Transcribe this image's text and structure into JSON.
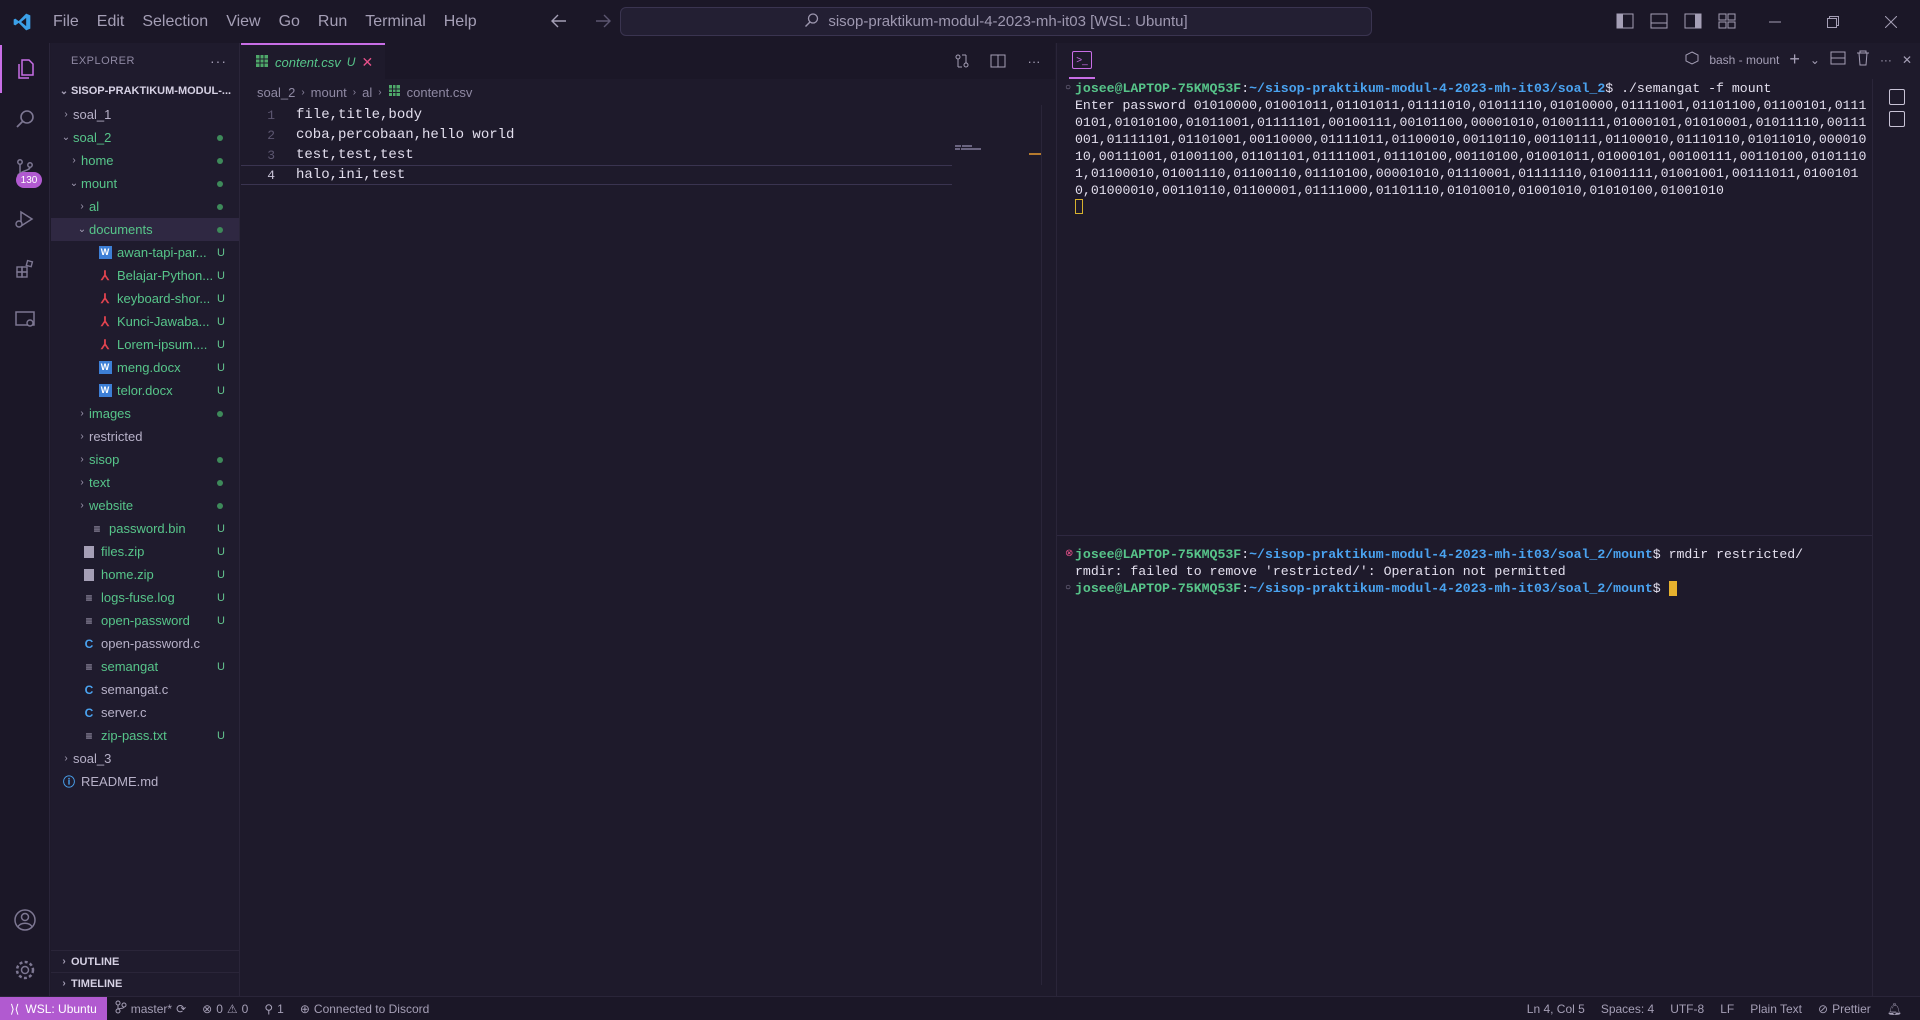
{
  "menubar": [
    "File",
    "Edit",
    "Selection",
    "View",
    "Go",
    "Run",
    "Terminal",
    "Help"
  ],
  "command_center": "sisop-praktikum-modul-4-2023-mh-it03 [WSL: Ubuntu]",
  "activity": {
    "scm_badge": "130"
  },
  "explorer": {
    "title": "EXPLORER",
    "root": "SISOP-PRAKTIKUM-MODUL-...",
    "items": [
      {
        "name": "soal_1",
        "indent": 0,
        "type": "folder-closed",
        "status": "",
        "color": "dim"
      },
      {
        "name": "soal_2",
        "indent": 0,
        "type": "folder-open",
        "status": "dot",
        "color": "green"
      },
      {
        "name": "home",
        "indent": 1,
        "type": "folder-closed",
        "status": "dot",
        "color": "green"
      },
      {
        "name": "mount",
        "indent": 1,
        "type": "folder-open",
        "status": "dot",
        "color": "green"
      },
      {
        "name": "al",
        "indent": 2,
        "type": "folder-closed",
        "status": "dot",
        "color": "green"
      },
      {
        "name": "documents",
        "indent": 2,
        "type": "folder-open",
        "status": "dot",
        "color": "green",
        "selected": true
      },
      {
        "name": "awan-tapi-par...",
        "indent": 3,
        "type": "word",
        "status": "U",
        "color": "green"
      },
      {
        "name": "Belajar-Python...",
        "indent": 3,
        "type": "pdf",
        "status": "U",
        "color": "green"
      },
      {
        "name": "keyboard-shor...",
        "indent": 3,
        "type": "pdf",
        "status": "U",
        "color": "green"
      },
      {
        "name": "Kunci-Jawaba...",
        "indent": 3,
        "type": "pdf",
        "status": "U",
        "color": "green"
      },
      {
        "name": "Lorem-ipsum....",
        "indent": 3,
        "type": "pdf",
        "status": "U",
        "color": "green"
      },
      {
        "name": "meng.docx",
        "indent": 3,
        "type": "word",
        "status": "U",
        "color": "green"
      },
      {
        "name": "telor.docx",
        "indent": 3,
        "type": "word",
        "status": "U",
        "color": "green"
      },
      {
        "name": "images",
        "indent": 2,
        "type": "folder-closed",
        "status": "dot",
        "color": "green"
      },
      {
        "name": "restricted",
        "indent": 2,
        "type": "folder-closed",
        "status": "",
        "color": "dim"
      },
      {
        "name": "sisop",
        "indent": 2,
        "type": "folder-closed",
        "status": "dot",
        "color": "green"
      },
      {
        "name": "text",
        "indent": 2,
        "type": "folder-closed",
        "status": "dot",
        "color": "green"
      },
      {
        "name": "website",
        "indent": 2,
        "type": "folder-closed",
        "status": "dot",
        "color": "green"
      },
      {
        "name": "password.bin",
        "indent": 2,
        "type": "text",
        "status": "U",
        "color": "green"
      },
      {
        "name": "files.zip",
        "indent": 1,
        "type": "zip",
        "status": "U",
        "color": "green"
      },
      {
        "name": "home.zip",
        "indent": 1,
        "type": "zip",
        "status": "U",
        "color": "green"
      },
      {
        "name": "logs-fuse.log",
        "indent": 1,
        "type": "text",
        "status": "U",
        "color": "green"
      },
      {
        "name": "open-password",
        "indent": 1,
        "type": "text",
        "status": "U",
        "color": "green"
      },
      {
        "name": "open-password.c",
        "indent": 1,
        "type": "c",
        "status": "",
        "color": "dim"
      },
      {
        "name": "semangat",
        "indent": 1,
        "type": "text",
        "status": "U",
        "color": "green"
      },
      {
        "name": "semangat.c",
        "indent": 1,
        "type": "c",
        "status": "",
        "color": "dim"
      },
      {
        "name": "server.c",
        "indent": 1,
        "type": "c",
        "status": "",
        "color": "dim"
      },
      {
        "name": "zip-pass.txt",
        "indent": 1,
        "type": "text",
        "status": "U",
        "color": "green"
      },
      {
        "name": "soal_3",
        "indent": 0,
        "type": "folder-closed",
        "status": "",
        "color": "dim"
      },
      {
        "name": "README.md",
        "indent": -1,
        "type": "info",
        "status": "",
        "color": "dim"
      }
    ],
    "outline": "OUTLINE",
    "timeline": "TIMELINE"
  },
  "editor": {
    "tab": {
      "name": "content.csv",
      "modified": "U"
    },
    "breadcrumb": [
      "soal_2",
      "mount",
      "al",
      "content.csv"
    ],
    "lines": [
      {
        "n": "1",
        "text": "file,title,body"
      },
      {
        "n": "2",
        "text": "coba,percobaan,hello world"
      },
      {
        "n": "3",
        "text": "test,test,test"
      },
      {
        "n": "4",
        "text": "halo,ini,test"
      }
    ]
  },
  "terminal": {
    "tab_label": "bash - mount",
    "pane1": {
      "user": "josee@LAPTOP-75KMQ53F",
      "path": "~/sisop-praktikum-modul-4-2023-mh-it03/soal_2",
      "command": "./semangat -f mount",
      "output": "Enter password 01010000,01001011,01101011,01111010,01011110,01010000,01111001,01101100,01100101,01110101,01010100,01011001,01111101,00100111,00101100,00001010,01001111,01000101,01010001,01011110,00111001,01111101,01101001,00110000,01111011,01100010,00110110,00110111,01100010,01110110,01011010,00001010,00111001,01001100,01101101,01111001,01110100,00110100,01001011,01000101,00100111,00110100,01011101,01100010,01001110,01100110,01110100,00001010,01110001,01111110,01001111,01001001,00111011,01001010,01000010,00110110,01100001,01111000,01101110,01010010,01001010,01010100,01001010"
    },
    "pane2": {
      "user": "josee@LAPTOP-75KMQ53F",
      "path": "~/sisop-praktikum-modul-4-2023-mh-it03/soal_2/mount",
      "command": "rmdir restricted/",
      "output": "rmdir: failed to remove 'restricted/': Operation not permitted",
      "prompt_path": "~/sisop-praktikum-modul-4-2023-mh-it03/soal_2/mount"
    }
  },
  "statusbar": {
    "remote": "WSL: Ubuntu",
    "branch": "master*",
    "errors": "0",
    "warnings": "0",
    "ports": "1",
    "discord": "Connected to Discord",
    "position": "Ln 4, Col 5",
    "spaces": "Spaces: 4",
    "encoding": "UTF-8",
    "eol": "LF",
    "language": "Plain Text",
    "prettier": "Prettier"
  },
  "colors": {
    "accent": "#c86ee6",
    "green": "#57c58a",
    "path_blue": "#4aa3f0",
    "error": "#e6508a"
  }
}
